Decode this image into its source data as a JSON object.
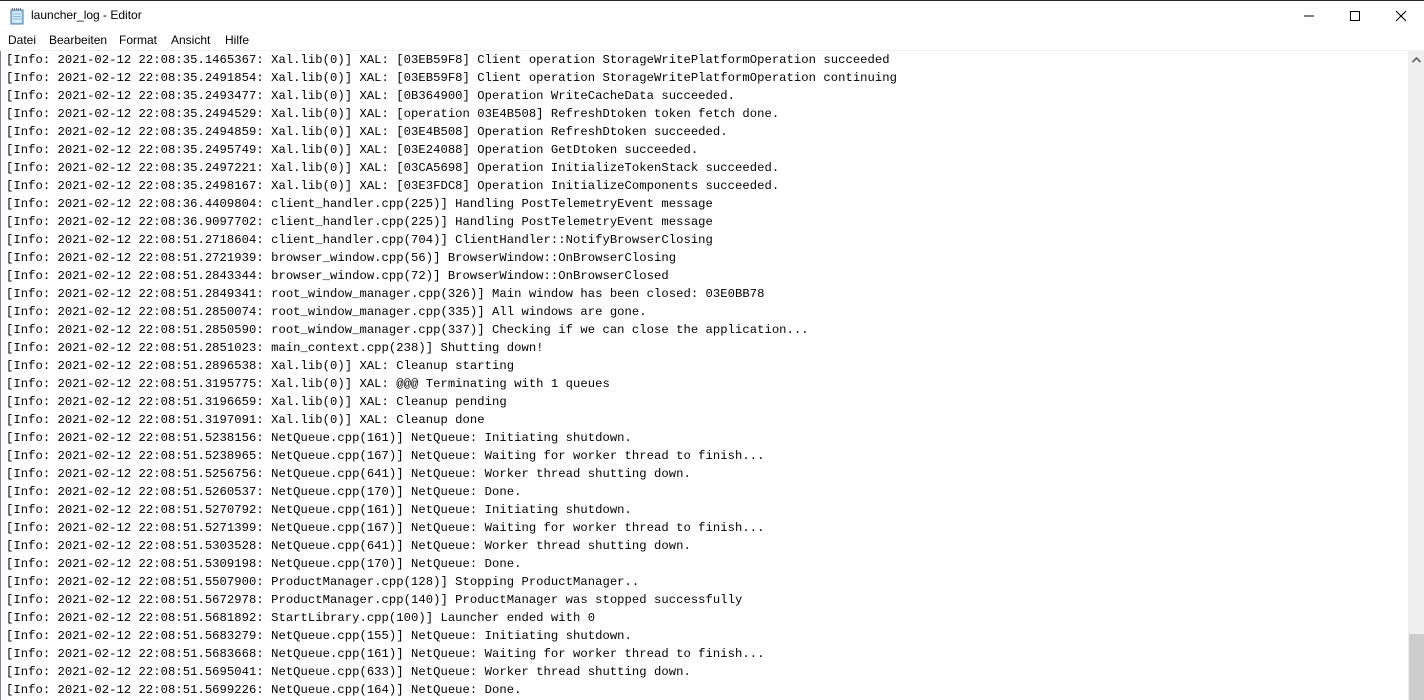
{
  "window": {
    "title": "launcher_log - Editor",
    "controls": {
      "minimize": "minimize",
      "maximize": "maximize",
      "close": "close"
    }
  },
  "menu": {
    "items": [
      "Datei",
      "Bearbeiten",
      "Format",
      "Ansicht",
      "Hilfe"
    ]
  },
  "editor": {
    "lines": [
      "[Info: 2021-02-12 22:08:35.1465367: Xal.lib(0)] XAL: [03EB59F8] Client operation StorageWritePlatformOperation succeeded",
      "[Info: 2021-02-12 22:08:35.2491854: Xal.lib(0)] XAL: [03EB59F8] Client operation StorageWritePlatformOperation continuing",
      "[Info: 2021-02-12 22:08:35.2493477: Xal.lib(0)] XAL: [0B364900] Operation WriteCacheData succeeded.",
      "[Info: 2021-02-12 22:08:35.2494529: Xal.lib(0)] XAL: [operation 03E4B508] RefreshDtoken token fetch done.",
      "[Info: 2021-02-12 22:08:35.2494859: Xal.lib(0)] XAL: [03E4B508] Operation RefreshDtoken succeeded.",
      "[Info: 2021-02-12 22:08:35.2495749: Xal.lib(0)] XAL: [03E24088] Operation GetDtoken succeeded.",
      "[Info: 2021-02-12 22:08:35.2497221: Xal.lib(0)] XAL: [03CA5698] Operation InitializeTokenStack succeeded.",
      "[Info: 2021-02-12 22:08:35.2498167: Xal.lib(0)] XAL: [03E3FDC8] Operation InitializeComponents succeeded.",
      "[Info: 2021-02-12 22:08:36.4409804: client_handler.cpp(225)] Handling PostTelemetryEvent message",
      "[Info: 2021-02-12 22:08:36.9097702: client_handler.cpp(225)] Handling PostTelemetryEvent message",
      "[Info: 2021-02-12 22:08:51.2718604: client_handler.cpp(704)] ClientHandler::NotifyBrowserClosing",
      "[Info: 2021-02-12 22:08:51.2721939: browser_window.cpp(56)] BrowserWindow::OnBrowserClosing",
      "[Info: 2021-02-12 22:08:51.2843344: browser_window.cpp(72)] BrowserWindow::OnBrowserClosed",
      "[Info: 2021-02-12 22:08:51.2849341: root_window_manager.cpp(326)] Main window has been closed: 03E0BB78",
      "[Info: 2021-02-12 22:08:51.2850074: root_window_manager.cpp(335)] All windows are gone.",
      "[Info: 2021-02-12 22:08:51.2850590: root_window_manager.cpp(337)] Checking if we can close the application...",
      "[Info: 2021-02-12 22:08:51.2851023: main_context.cpp(238)] Shutting down!",
      "[Info: 2021-02-12 22:08:51.2896538: Xal.lib(0)] XAL: Cleanup starting",
      "[Info: 2021-02-12 22:08:51.3195775: Xal.lib(0)] XAL: @@@ Terminating with 1 queues",
      "[Info: 2021-02-12 22:08:51.3196659: Xal.lib(0)] XAL: Cleanup pending",
      "[Info: 2021-02-12 22:08:51.3197091: Xal.lib(0)] XAL: Cleanup done",
      "[Info: 2021-02-12 22:08:51.5238156: NetQueue.cpp(161)] NetQueue: Initiating shutdown.",
      "[Info: 2021-02-12 22:08:51.5238965: NetQueue.cpp(167)] NetQueue: Waiting for worker thread to finish...",
      "[Info: 2021-02-12 22:08:51.5256756: NetQueue.cpp(641)] NetQueue: Worker thread shutting down.",
      "[Info: 2021-02-12 22:08:51.5260537: NetQueue.cpp(170)] NetQueue: Done.",
      "[Info: 2021-02-12 22:08:51.5270792: NetQueue.cpp(161)] NetQueue: Initiating shutdown.",
      "[Info: 2021-02-12 22:08:51.5271399: NetQueue.cpp(167)] NetQueue: Waiting for worker thread to finish...",
      "[Info: 2021-02-12 22:08:51.5303528: NetQueue.cpp(641)] NetQueue: Worker thread shutting down.",
      "[Info: 2021-02-12 22:08:51.5309198: NetQueue.cpp(170)] NetQueue: Done.",
      "[Info: 2021-02-12 22:08:51.5507900: ProductManager.cpp(128)] Stopping ProductManager..",
      "[Info: 2021-02-12 22:08:51.5672978: ProductManager.cpp(140)] ProductManager was stopped successfully",
      "[Info: 2021-02-12 22:08:51.5681892: StartLibrary.cpp(100)] Launcher ended with 0",
      "[Info: 2021-02-12 22:08:51.5683279: NetQueue.cpp(155)] NetQueue: Initiating shutdown.",
      "[Info: 2021-02-12 22:08:51.5683668: NetQueue.cpp(161)] NetQueue: Waiting for worker thread to finish...",
      "[Info: 2021-02-12 22:08:51.5695041: NetQueue.cpp(633)] NetQueue: Worker thread shutting down.",
      "[Info: 2021-02-12 22:08:51.5699226: NetQueue.cpp(164)] NetQueue: Done."
    ]
  },
  "scrollbar": {
    "position_fraction": 0.9
  },
  "colors": {
    "scroll_track": "#f0f0f0",
    "scroll_thumb": "#cdcdcd",
    "text": "#000000"
  }
}
